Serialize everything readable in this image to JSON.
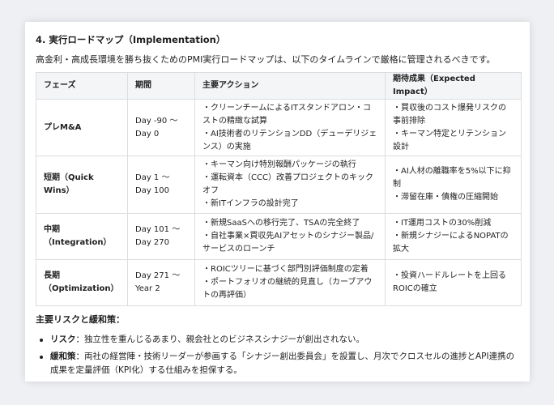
{
  "section_title": "4. 実行ロードマップ（Implementation）",
  "intro": "高金利・高成長環境を勝ち抜くためのPMI実行ロードマップは、以下のタイムラインで厳格に管理されるべきです。",
  "table": {
    "headers": [
      "フェーズ",
      "期間",
      "主要アクション",
      "期待成果（Expected Impact）"
    ],
    "rows": [
      {
        "phase": "プレM&A",
        "period": "Day -90 〜 Day 0",
        "actions": [
          "・クリーンチームによるITスタンドアロン・コストの精緻な試算",
          "・AI技術者のリテンションDD（デューデリジェンス）の実施"
        ],
        "impact": [
          "・買収後のコスト爆発リスクの事前排除",
          "・キーマン特定とリテンション設計"
        ]
      },
      {
        "phase": "短期（Quick Wins）",
        "period": "Day 1 〜 Day 100",
        "actions": [
          "・キーマン向け特別報酬パッケージの執行",
          "・運転資本（CCC）改善プロジェクトのキックオフ",
          "・新ITインフラの設計完了"
        ],
        "impact": [
          "・AI人材の離職率を5%以下に抑制",
          "・滞留在庫・債権の圧縮開始"
        ]
      },
      {
        "phase": "中期（Integration）",
        "period": "Day 101 〜 Day 270",
        "actions": [
          "・新規SaaSへの移行完了、TSAの完全終了",
          "・自社事業×買収先AIアセットのシナジー製品/サービスのローンチ"
        ],
        "impact": [
          "・IT運用コストの30%削減",
          "・新規シナジーによるNOPATの拡大"
        ]
      },
      {
        "phase": "長期（Optimization）",
        "period": "Day 271 〜 Year 2",
        "actions": [
          "・ROICツリーに基づく部門別評価制度の定着",
          "・ポートフォリオの継続的見直し（カーブアウトの再評価）"
        ],
        "impact": [
          "・投資ハードルレートを上回るROICの確立"
        ]
      }
    ]
  },
  "risks_title": "主要リスクと緩和策：",
  "risks": [
    {
      "label": "リスク",
      "text": "：独立性を重んじるあまり、親会社とのビジネスシナジーが創出されない。"
    },
    {
      "label": "緩和策",
      "text": "：両社の経営陣・技術リーダーが参画する「シナジー創出委員会」を設置し、月次でクロスセルの進捗とAPI連携の成果を定量評価（KPI化）する仕組みを担保する。"
    }
  ]
}
